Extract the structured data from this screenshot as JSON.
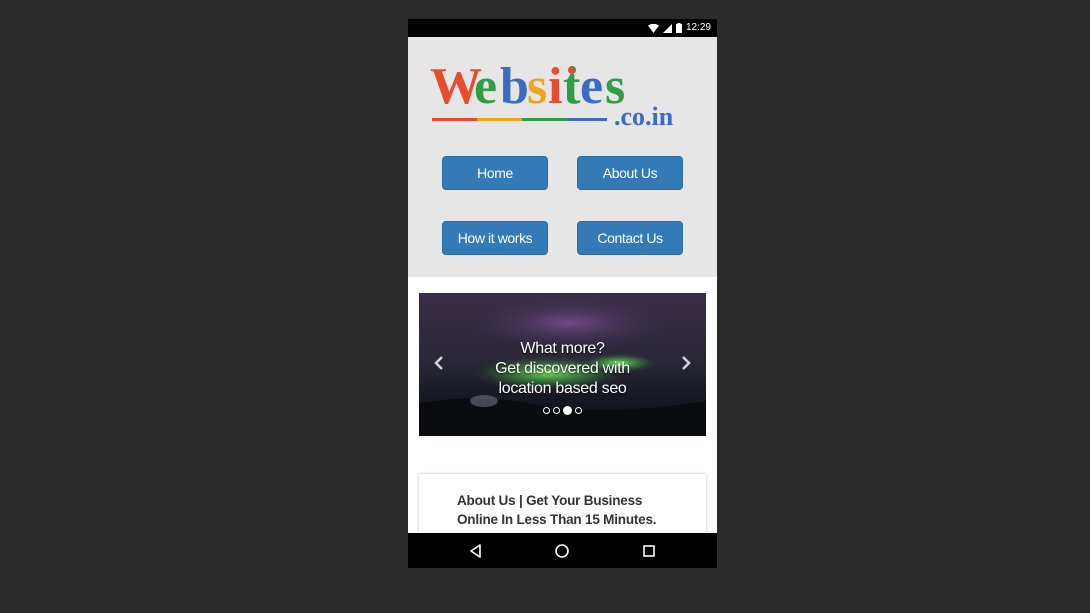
{
  "status_bar": {
    "time": "12:29"
  },
  "logo": {
    "main": "Websites",
    "sub": ".co.in"
  },
  "nav": {
    "home": "Home",
    "about": "About Us",
    "how": "How it works",
    "contact": "Contact Us"
  },
  "carousel": {
    "caption_line1": "What more?",
    "caption_line2": "Get discovered with",
    "caption_line3": "location based seo",
    "prev_icon": "chevron-left-icon",
    "next_icon": "chevron-right-icon",
    "slides": 4,
    "active_slide": 3
  },
  "about": {
    "line1": "About Us | Get Your Business",
    "line2": "Online In Less Than 15 Minutes."
  },
  "colors": {
    "button": "#337ab7",
    "header_bg": "#e6e6e6",
    "page_bg": "#2a2a2a"
  }
}
